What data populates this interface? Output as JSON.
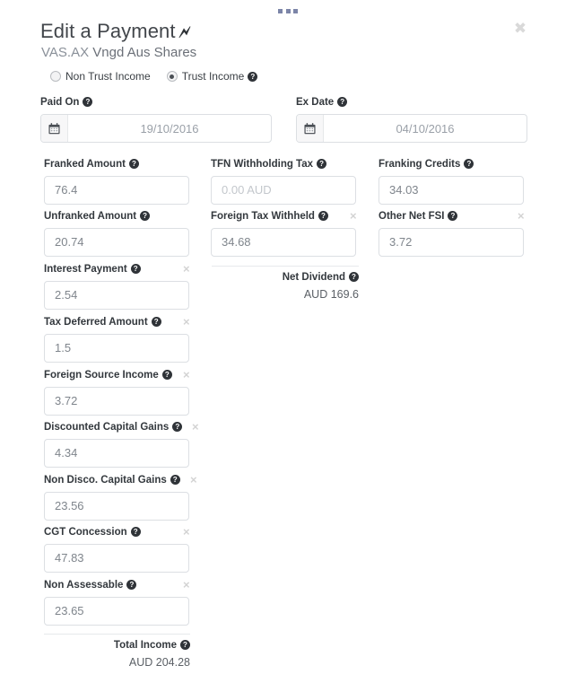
{
  "window": {
    "drag_handle": "drag-handle",
    "close_label": "✖"
  },
  "header": {
    "title": "Edit a Payment",
    "title_icon": "🗲",
    "security_code": "VAS.AX",
    "security_name": "Vngd Aus Shares"
  },
  "income_type": {
    "options": [
      {
        "label": "Non Trust Income",
        "selected": false
      },
      {
        "label": "Trust Income",
        "selected": true
      }
    ],
    "help": "?"
  },
  "dates": [
    {
      "label": "Paid On",
      "value": "19/10/2016",
      "icon": "calendar-icon"
    },
    {
      "label": "Ex Date",
      "value": "04/10/2016",
      "icon": "calendar-icon"
    }
  ],
  "fields": {
    "franked_amount": {
      "label": "Franked Amount",
      "value": "76.4",
      "placeholder": "",
      "removable": false
    },
    "tfn_withholding_tax": {
      "label": "TFN Withholding Tax",
      "value": "",
      "placeholder": "0.00 AUD",
      "removable": false
    },
    "franking_credits": {
      "label": "Franking Credits",
      "value": "34.03",
      "placeholder": "",
      "removable": false
    },
    "unfranked_amount": {
      "label": "Unfranked Amount",
      "value": "20.74",
      "placeholder": "",
      "removable": false
    },
    "foreign_tax_withheld": {
      "label": "Foreign Tax Withheld",
      "value": "34.68",
      "placeholder": "",
      "removable": true
    },
    "other_net_fsi": {
      "label": "Other Net FSI",
      "value": "3.72",
      "placeholder": "",
      "removable": true
    },
    "interest_payment": {
      "label": "Interest Payment",
      "value": "2.54",
      "placeholder": "",
      "removable": true
    },
    "tax_deferred_amount": {
      "label": "Tax Deferred Amount",
      "value": "1.5",
      "placeholder": "",
      "removable": true
    },
    "foreign_source_income": {
      "label": "Foreign Source Income",
      "value": "3.72",
      "placeholder": "",
      "removable": true
    },
    "discounted_capital_gains": {
      "label": "Discounted Capital Gains",
      "value": "4.34",
      "placeholder": "",
      "removable": true
    },
    "non_disco_capital_gains": {
      "label": "Non Disco. Capital Gains",
      "value": "23.56",
      "placeholder": "",
      "removable": true
    },
    "cgt_concession": {
      "label": "CGT Concession",
      "value": "47.83",
      "placeholder": "",
      "removable": true
    },
    "non_assessable": {
      "label": "Non Assessable",
      "value": "23.65",
      "placeholder": "",
      "removable": true
    }
  },
  "summaries": {
    "net_dividend": {
      "label": "Net Dividend",
      "value": "AUD 169.6"
    },
    "total_income": {
      "label": "Total Income",
      "value": "AUD 204.28"
    }
  },
  "remove_glyph": "×",
  "colors": {
    "text": "#3a3f44",
    "muted": "#7f858c",
    "placeholder": "#c3c7cc",
    "border": "#dcdfe3",
    "handle": "#7c85a8"
  }
}
